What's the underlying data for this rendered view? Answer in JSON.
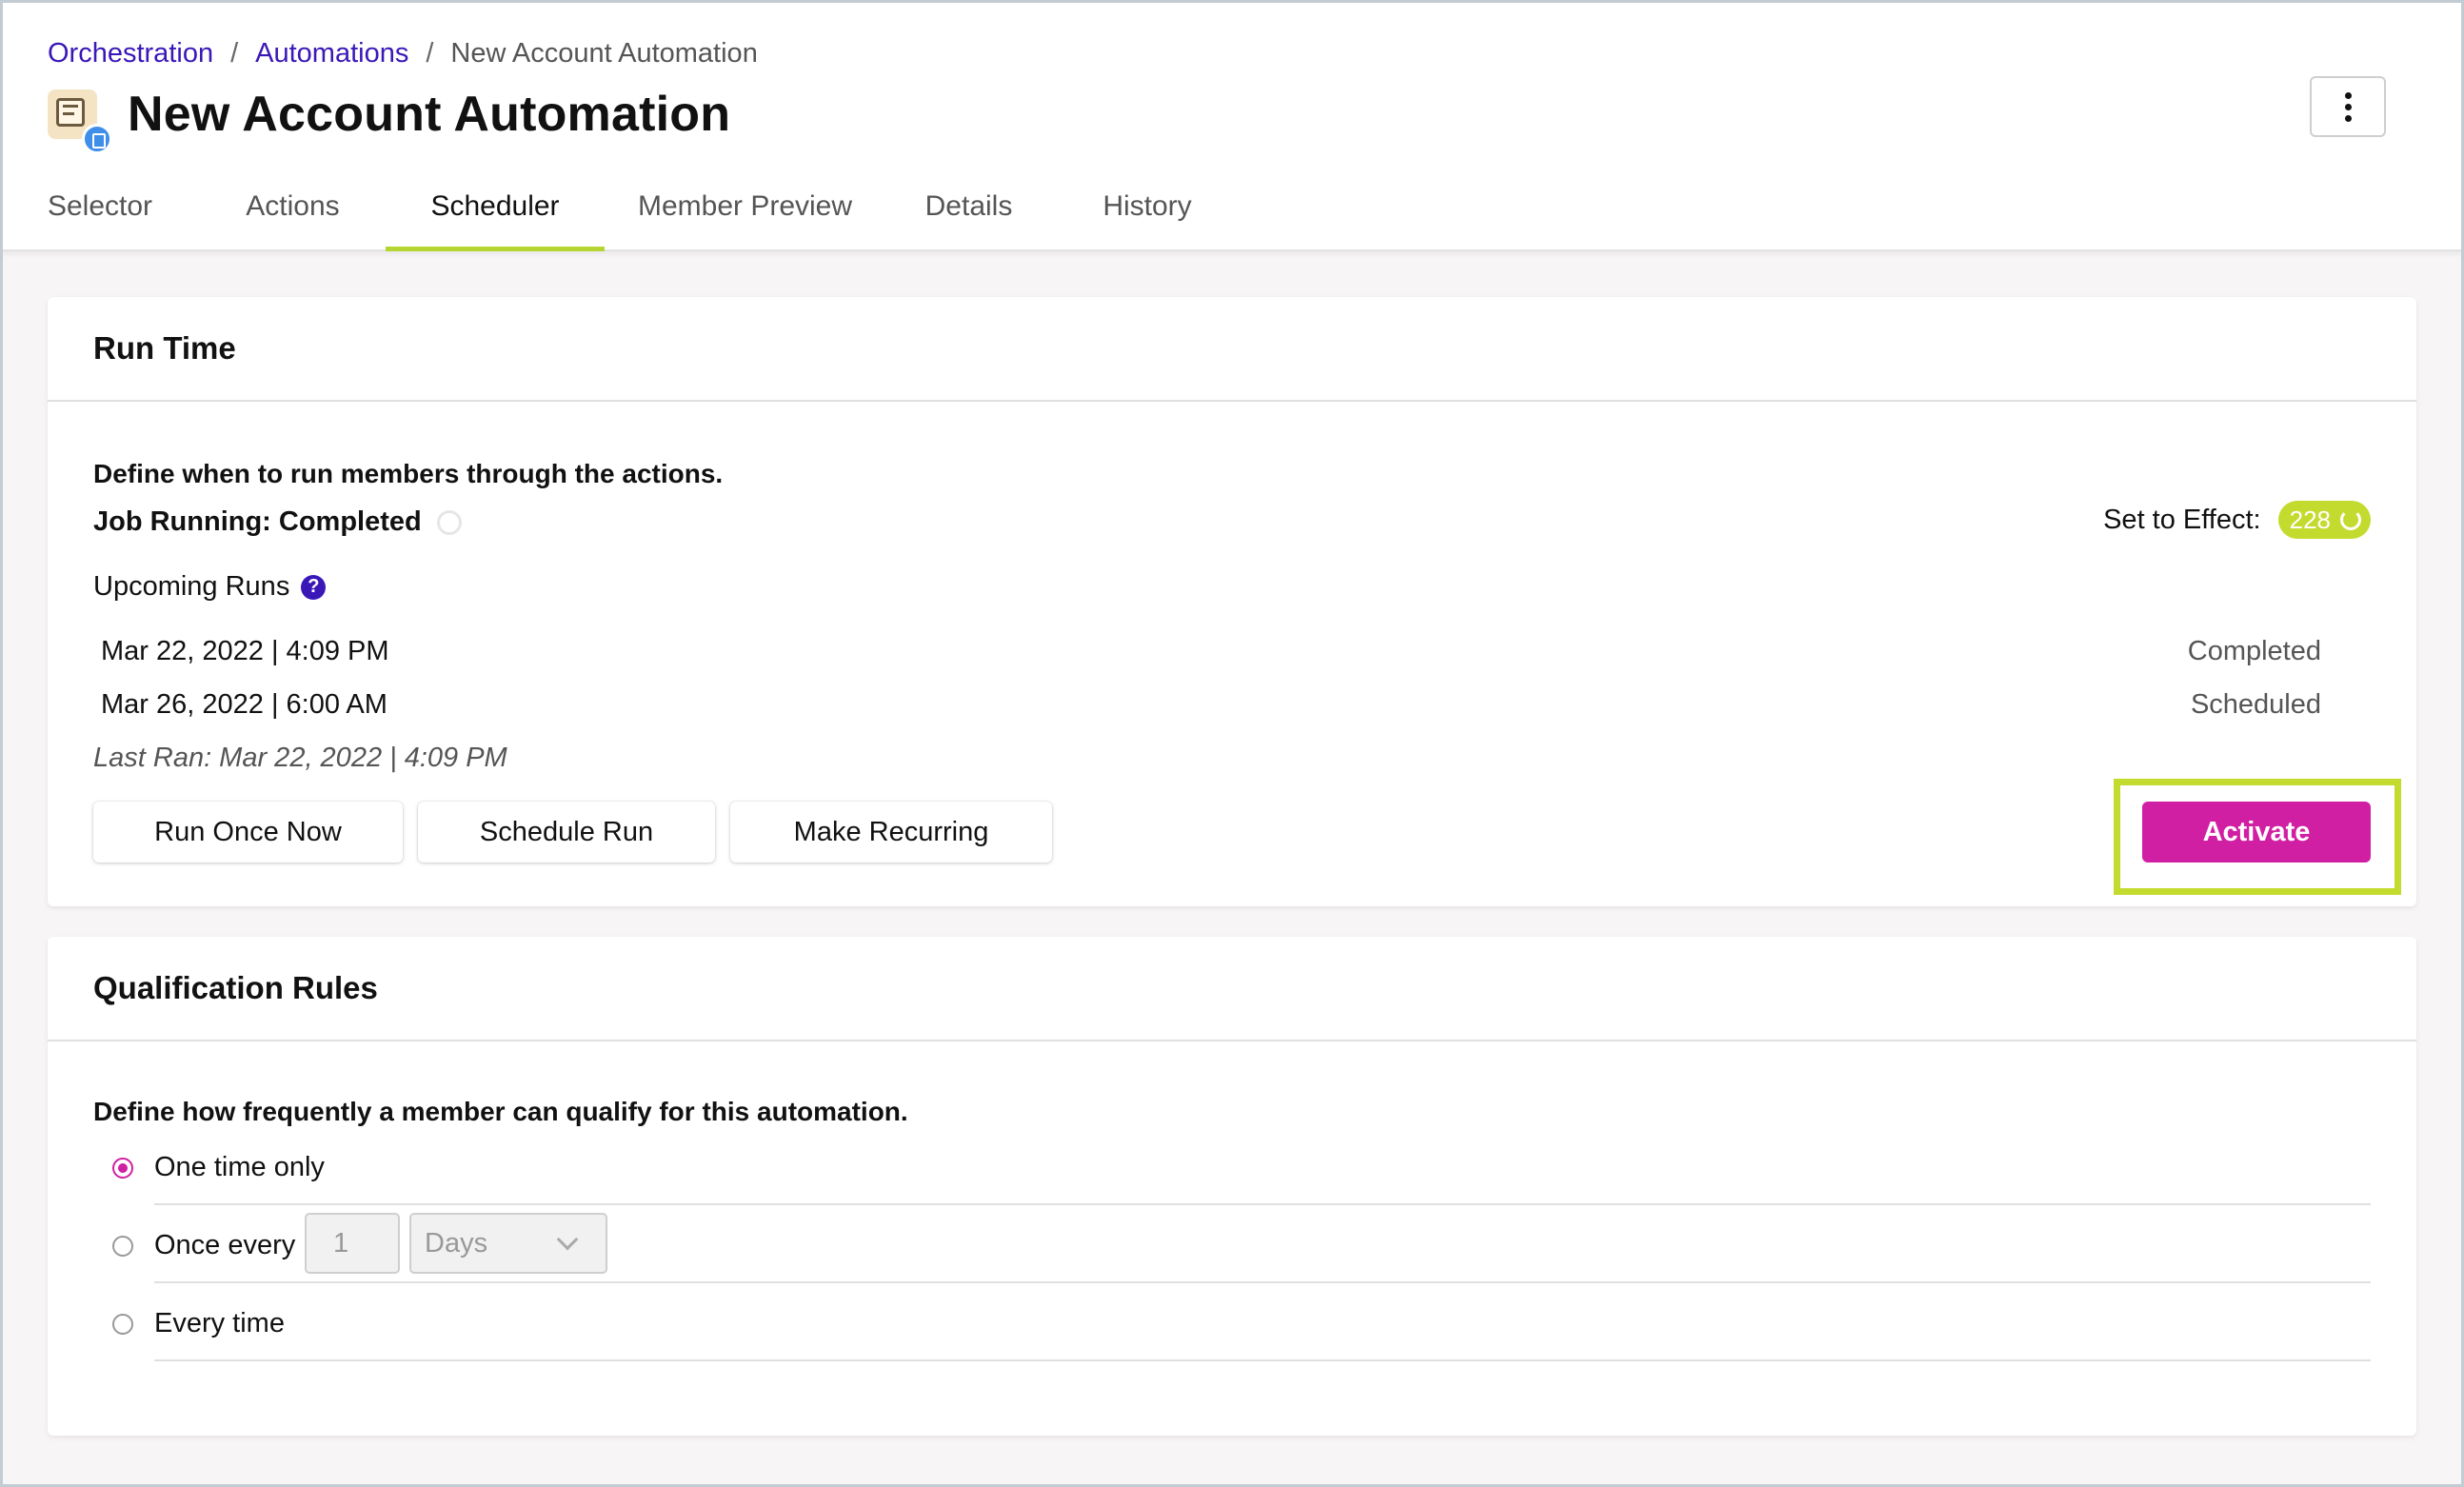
{
  "breadcrumb": {
    "items": [
      "Orchestration",
      "Automations"
    ],
    "separator": "/",
    "current": "New Account Automation"
  },
  "header": {
    "title": "New Account Automation",
    "app_icon": "automation-icon",
    "more_icon": "more-vertical-icon"
  },
  "tabs": [
    {
      "label": "Selector",
      "active": false
    },
    {
      "label": "Actions",
      "active": false
    },
    {
      "label": "Scheduler",
      "active": true
    },
    {
      "label": "Member Preview",
      "active": false
    },
    {
      "label": "Details",
      "active": false
    },
    {
      "label": "History",
      "active": false
    }
  ],
  "run_time": {
    "title": "Run Time",
    "description": "Define when to run members through the actions.",
    "job_status": "Job Running: Completed",
    "upcoming_label": "Upcoming Runs",
    "help_icon": "?",
    "runs": [
      {
        "date": "Mar 22, 2022 | 4:09 PM",
        "status": "Completed"
      },
      {
        "date": "Mar 26, 2022 | 6:00 AM",
        "status": "Scheduled"
      }
    ],
    "last_ran": "Last Ran: Mar 22, 2022 | 4:09 PM",
    "set_to_effect_label": "Set to Effect:",
    "set_to_effect_count": "228",
    "buttons": {
      "run_once": "Run Once Now",
      "schedule": "Schedule Run",
      "recurring": "Make Recurring",
      "activate": "Activate"
    }
  },
  "qualification": {
    "title": "Qualification Rules",
    "description": "Define how frequently a member can qualify for this automation.",
    "options": [
      {
        "label": "One time only",
        "checked": true
      },
      {
        "label": "Once every",
        "checked": false
      },
      {
        "label": "Every time",
        "checked": false
      }
    ],
    "interval_value": "1",
    "interval_unit": "Days"
  },
  "colors": {
    "accent_green": "#c3db2e",
    "primary_magenta": "#d11fa4",
    "link_purple": "#3a18b8"
  }
}
